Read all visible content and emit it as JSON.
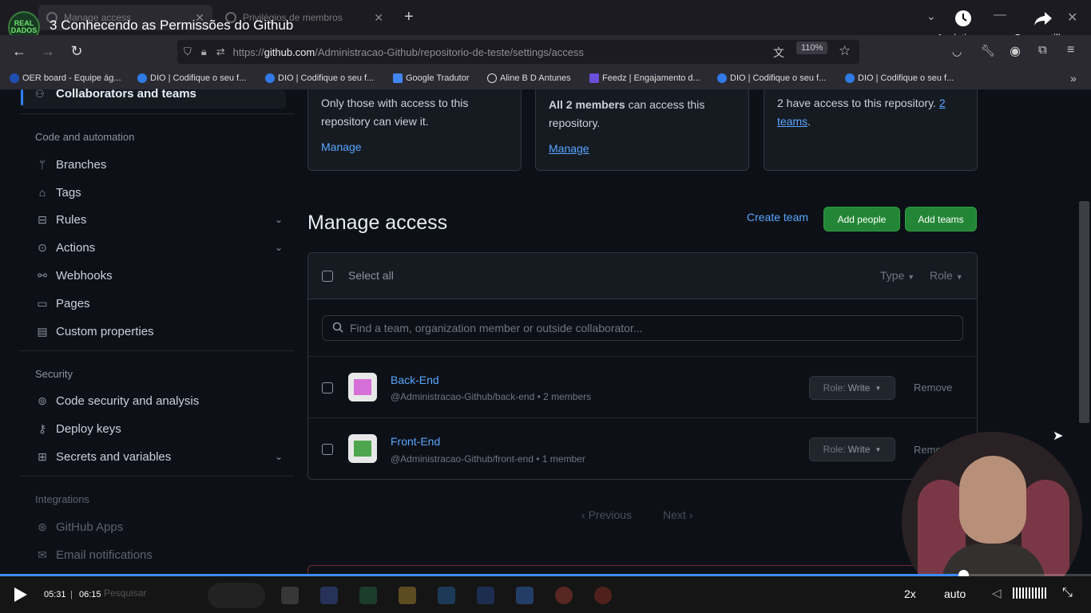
{
  "video": {
    "title": "3 Conhecendo as Permissões do Github",
    "channel_logo_text": "REAL DADOS",
    "watch_later": "Assistir m...",
    "share": "Compartilh...",
    "current_time": "05:31",
    "duration": "06:15",
    "progress_fraction": 0.883,
    "speed": "2x",
    "quality": "auto",
    "taskbar_search": "Pesquisar"
  },
  "browser": {
    "tabs": [
      {
        "label": "Manage access"
      },
      {
        "label": "Privilégios de membros"
      }
    ],
    "url_prefix": "https://",
    "url_host": "github.com",
    "url_path": "/Administracao-Github/repositorio-de-teste/settings/access",
    "zoom": "110%",
    "bookmarks": [
      "OER board - Equipe ág...",
      "DIO | Codifique o seu f...",
      "DIO | Codifique o seu f...",
      "Google Tradutor",
      "Aline B D Antunes",
      "Feedz | Engajamento d...",
      "DIO | Codifique o seu f...",
      "DIO | Codifique o seu f..."
    ]
  },
  "sidebar": {
    "collaborators": "Collaborators and teams",
    "code_heading": "Code and automation",
    "items": [
      {
        "label": "Branches",
        "icon": "branch-icon"
      },
      {
        "label": "Tags",
        "icon": "tag-icon"
      },
      {
        "label": "Rules",
        "icon": "rules-icon"
      },
      {
        "label": "Actions",
        "icon": "play-circle-icon"
      },
      {
        "label": "Webhooks",
        "icon": "webhook-icon"
      },
      {
        "label": "Pages",
        "icon": "browser-icon"
      },
      {
        "label": "Custom properties",
        "icon": "note-icon"
      }
    ],
    "security_heading": "Security",
    "security_items": [
      {
        "label": "Code security and analysis",
        "icon": "codescan-icon"
      },
      {
        "label": "Deploy keys",
        "icon": "key-icon"
      },
      {
        "label": "Secrets and variables",
        "icon": "plus-square-icon"
      }
    ],
    "integrations_heading": "Integrations",
    "integration_items": [
      {
        "label": "GitHub Apps",
        "icon": "apps-icon"
      },
      {
        "label": "Email notifications",
        "icon": "mail-icon"
      }
    ]
  },
  "cards": {
    "visibility_text": "Only those with access to this repository can view it.",
    "visibility_link": "Manage",
    "members_bold": "All 2 members",
    "members_text": " can access this repository.",
    "members_link": "Manage",
    "access_text": "2 have access to this repository. ",
    "access_link_1": "2",
    "access_link_2": "teams",
    "access_period": "."
  },
  "manage_access": {
    "title": "Manage access",
    "create_team": "Create team",
    "add_people": "Add people",
    "add_teams": "Add teams",
    "select_all": "Select all",
    "type_filter": "Type",
    "role_filter": "Role",
    "search_placeholder": "Find a team, organization member or outside collaborator...",
    "rows": [
      {
        "name": "Back-End",
        "sub": "@Administracao-Github/back-end • 2 members",
        "role_label": "Role:",
        "role": "Write",
        "remove": "Remove",
        "avatar_color": "#d76fd8"
      },
      {
        "name": "Front-End",
        "sub": "@Administracao-Github/front-end • 1 member",
        "role_label": "Role:",
        "role": "Write",
        "remove": "Remove",
        "avatar_color": "#4ea64e"
      }
    ],
    "previous": "Previous",
    "next": "Next"
  }
}
